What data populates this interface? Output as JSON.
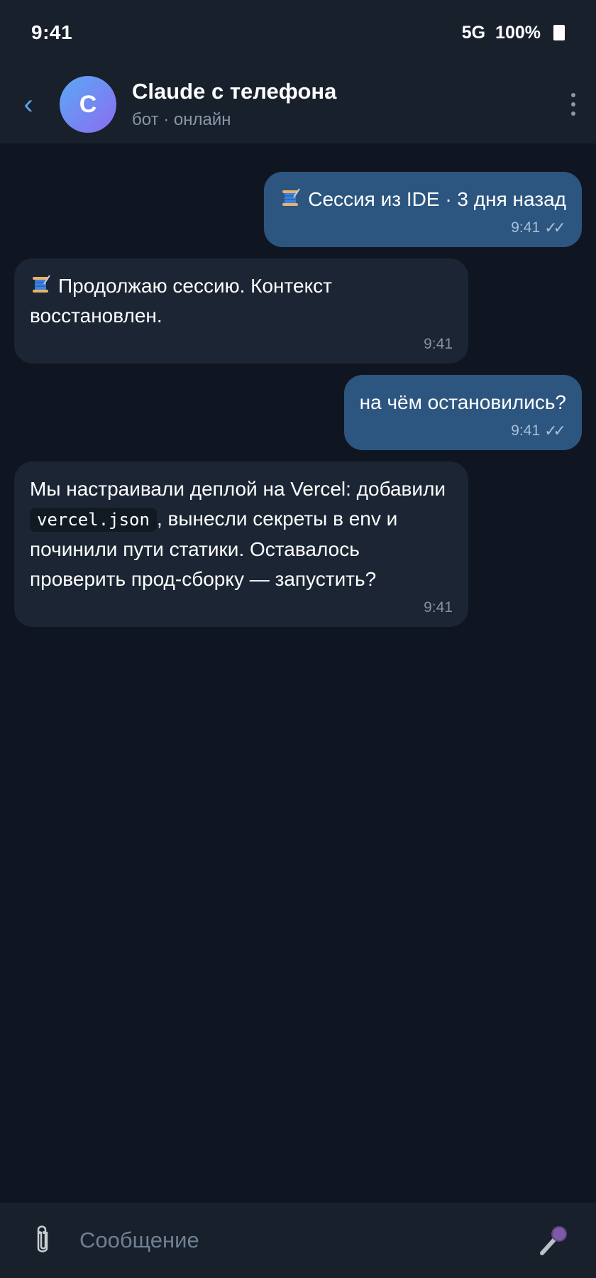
{
  "status_bar": {
    "time": "9:41",
    "network": "5G",
    "battery": "100%"
  },
  "header": {
    "avatar_letter": "C",
    "title": "Claude с телефона",
    "subtitle": "бот · онлайн"
  },
  "messages": [
    {
      "direction": "out",
      "icon": "spool-icon",
      "text": "Сессия из IDE · 3 дня назад",
      "time": "9:41",
      "status": "✓✓"
    },
    {
      "direction": "in",
      "icon": "spool-icon",
      "text": "Продолжаю сессию. Контекст восстановлен.",
      "time": "9:41"
    },
    {
      "direction": "out",
      "text": "на чём остановились?",
      "time": "9:41",
      "status": "✓✓"
    },
    {
      "direction": "in",
      "text_before": "Мы настраивали деплой на Vercel: добавили ",
      "code": "vercel.json",
      "text_after": ", вынесли секреты в env и починили пути статики. Оставалось проверить прод-сборку — запустить?",
      "time": "9:41"
    }
  ],
  "composer": {
    "placeholder": "Сообщение"
  },
  "colors": {
    "background": "#0f1621",
    "bar": "#17202b",
    "outgoing": "#2c5680",
    "incoming": "#1b2533",
    "accent": "#5aa2e6"
  }
}
